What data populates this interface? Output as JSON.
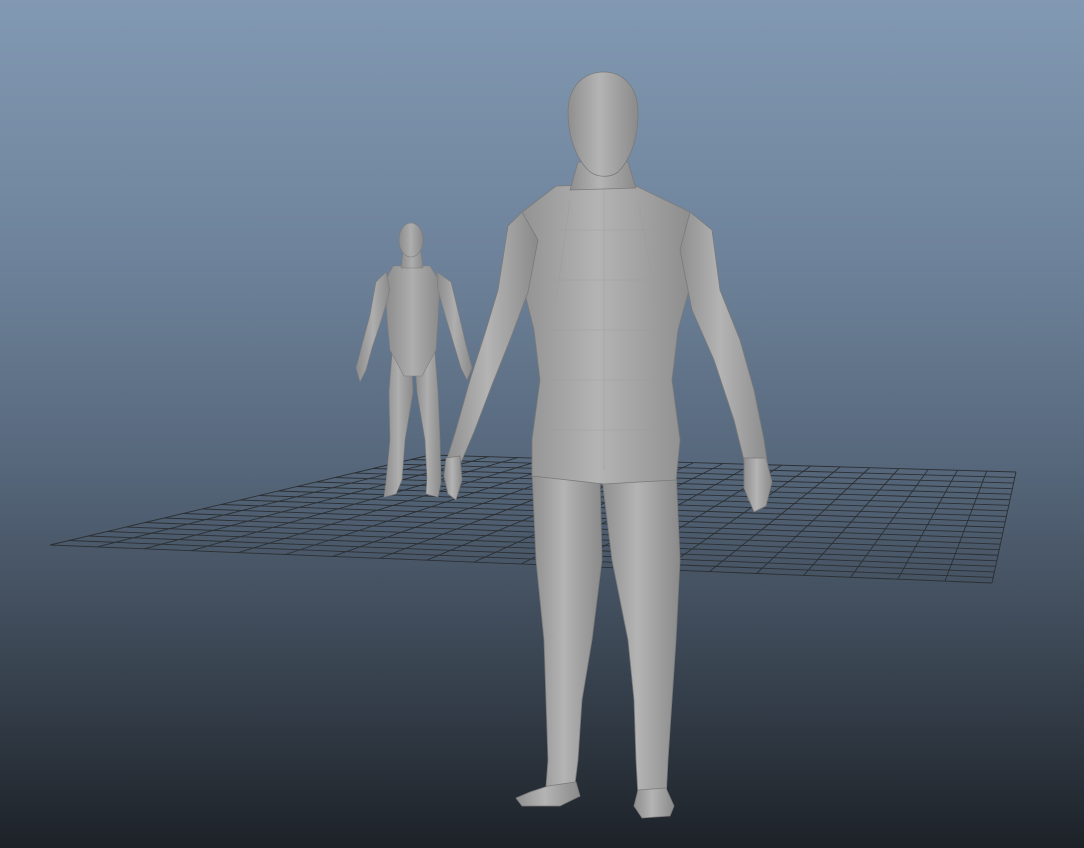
{
  "viewport": {
    "background_top": "#8299b3",
    "background_bottom": "#1d2228"
  },
  "scene": {
    "grid": {
      "color": "#2b2f33",
      "divisions": 20
    },
    "objects": [
      {
        "name": "human-figure-background",
        "material_color": "#a9a9a9"
      },
      {
        "name": "human-figure-foreground",
        "material_color": "#a9a9a9"
      }
    ]
  }
}
